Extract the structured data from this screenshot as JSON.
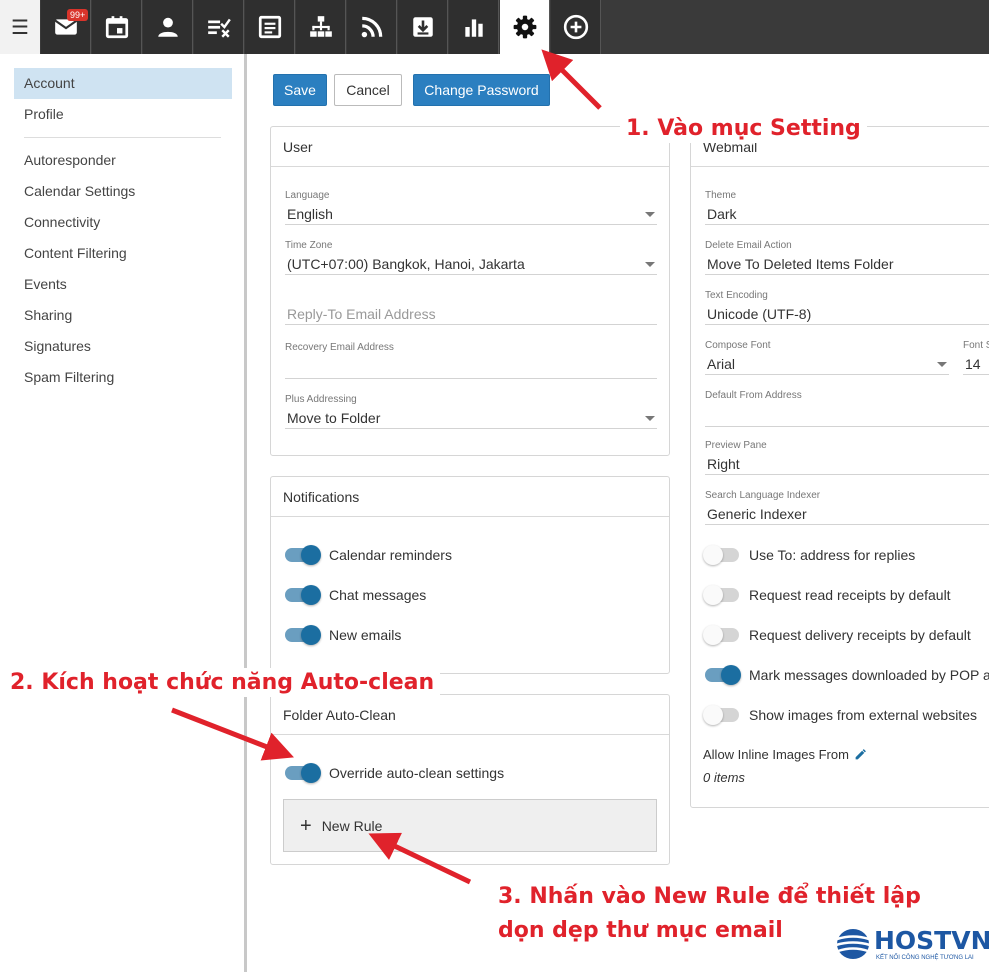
{
  "nav": {
    "badge": "99+",
    "items": [
      "mail-icon",
      "calendar-icon",
      "contacts-icon",
      "tasks-icon",
      "notes-icon",
      "sitemap-icon",
      "rss-icon",
      "download-icon",
      "reports-icon",
      "settings-icon",
      "add-icon"
    ]
  },
  "sidebar": {
    "items": [
      "Account",
      "Profile",
      "Autoresponder",
      "Calendar Settings",
      "Connectivity",
      "Content Filtering",
      "Events",
      "Sharing",
      "Signatures",
      "Spam Filtering"
    ],
    "active": "Account"
  },
  "toolbar": {
    "save": "Save",
    "cancel": "Cancel",
    "change_password": "Change Password"
  },
  "user_card": {
    "title": "User",
    "language_label": "Language",
    "language": "English",
    "timezone_label": "Time Zone",
    "timezone": "(UTC+07:00) Bangkok, Hanoi, Jakarta",
    "reply_to_placeholder": "Reply-To Email Address",
    "recovery_label": "Recovery Email Address",
    "recovery": "",
    "plus_label": "Plus Addressing",
    "plus": "Move to Folder"
  },
  "notifications": {
    "title": "Notifications",
    "items": [
      {
        "label": "Calendar reminders",
        "on": true
      },
      {
        "label": "Chat messages",
        "on": true
      },
      {
        "label": "New emails",
        "on": true
      }
    ]
  },
  "autoclean": {
    "title": "Folder Auto-Clean",
    "override_label": "Override auto-clean settings",
    "new_rule": "New Rule"
  },
  "webmail": {
    "title": "Webmail",
    "theme_label": "Theme",
    "theme": "Dark",
    "delete_label": "Delete Email Action",
    "delete": "Move To Deleted Items Folder",
    "encoding_label": "Text Encoding",
    "encoding": "Unicode (UTF-8)",
    "font_label": "Compose Font",
    "font": "Arial",
    "fontsize_label": "Font S",
    "fontsize": "14",
    "from_label": "Default From Address",
    "from": "",
    "preview_label": "Preview Pane",
    "preview": "Right",
    "indexer_label": "Search Language Indexer",
    "indexer": "Generic Indexer",
    "toggles": [
      {
        "label": "Use To: address for replies",
        "on": false
      },
      {
        "label": "Request read receipts by default",
        "on": false
      },
      {
        "label": "Request delivery receipts by default",
        "on": false
      },
      {
        "label": "Mark messages downloaded by POP as",
        "on": true
      },
      {
        "label": "Show images from external websites",
        "on": false
      }
    ],
    "inline_label": "Allow Inline Images From",
    "inline_count": "0 items"
  },
  "annotations": {
    "step1": "1. Vào mục Setting",
    "step2": "2. Kích hoạt chức năng Auto-clean",
    "step3_line1": "3. Nhấn vào New Rule để thiết lập",
    "step3_line2": "dọn dẹp thư mục email"
  },
  "logo": {
    "name": "HOSTVN",
    "tagline": "KẾT NỐI CÔNG NGHỆ TƯƠNG LAI"
  },
  "colors": {
    "accent": "#2b7fc0",
    "annotation": "#e0222b",
    "toggle_on": "#1b6ea1"
  }
}
